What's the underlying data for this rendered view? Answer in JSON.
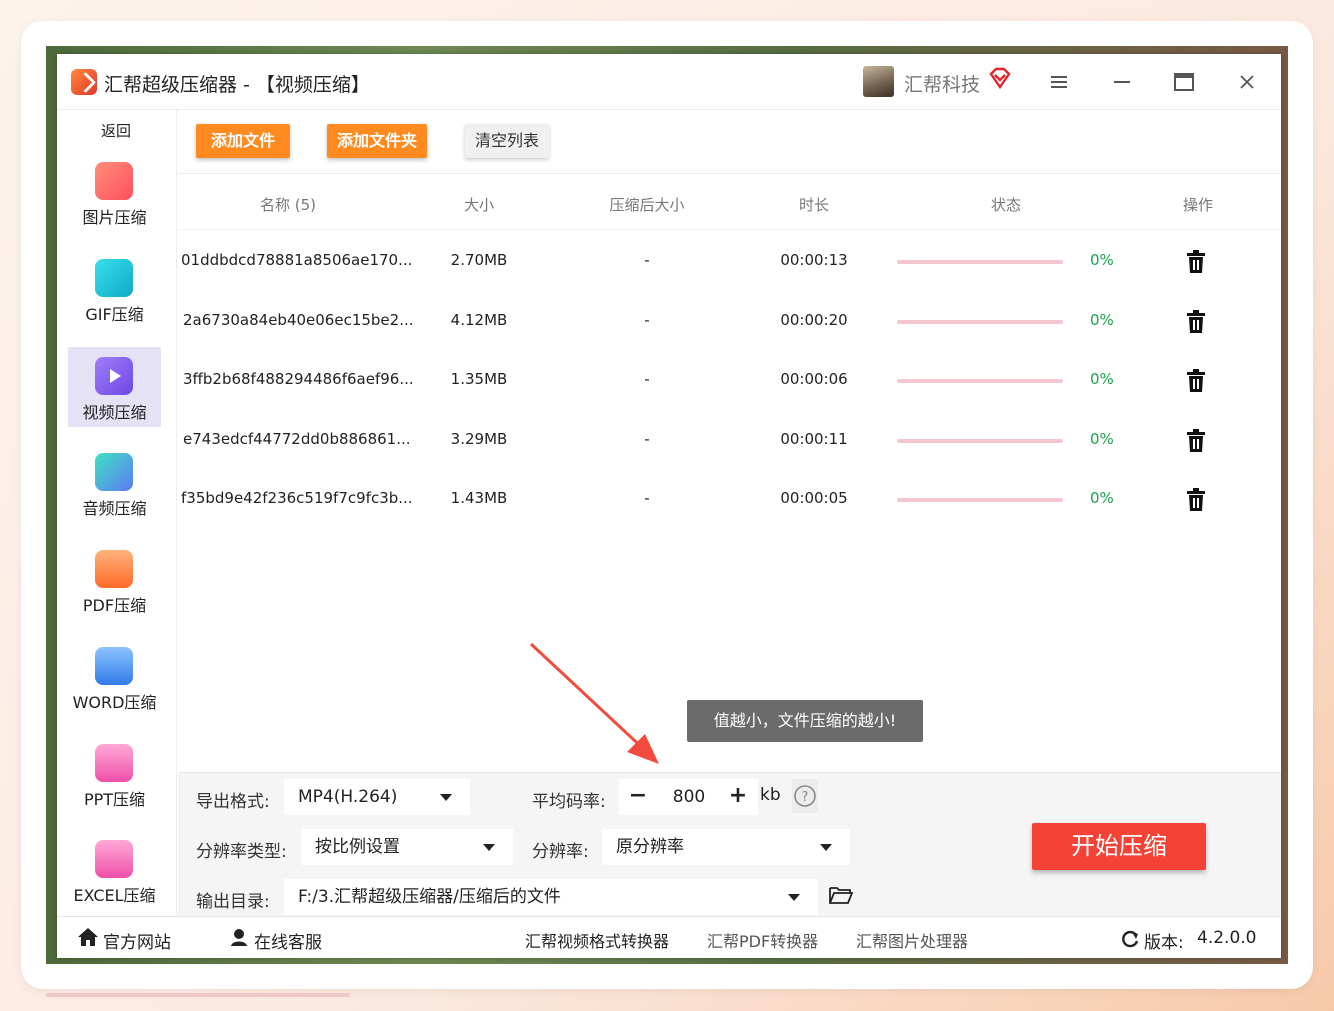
{
  "window": {
    "title": "汇帮超级压缩器  - 【视频压缩】",
    "brand": "汇帮科技"
  },
  "sidebar": {
    "back_label": "返回",
    "items": [
      {
        "label": "图片压缩",
        "icon": "image-compress-icon",
        "color": "#ff6b5a"
      },
      {
        "label": "GIF压缩",
        "icon": "gif-compress-icon",
        "color": "#1ec6d9"
      },
      {
        "label": "视频压缩",
        "icon": "video-compress-icon",
        "color": "#8a5cf0"
      },
      {
        "label": "音频压缩",
        "icon": "audio-compress-icon",
        "color": "#4aa3f0"
      },
      {
        "label": "PDF压缩",
        "icon": "pdf-compress-icon",
        "color": "#ff8a3d"
      },
      {
        "label": "WORD压缩",
        "icon": "word-compress-icon",
        "color": "#3d8bf0"
      },
      {
        "label": "PPT压缩",
        "icon": "ppt-compress-icon",
        "color": "#f064b4"
      },
      {
        "label": "EXCEL压缩",
        "icon": "excel-compress-icon",
        "color": "#f064b4"
      }
    ]
  },
  "toolbar": {
    "add_file": "添加文件",
    "add_folder": "添加文件夹",
    "clear_list": "清空列表"
  },
  "table": {
    "headers": [
      "名称 (5)",
      "大小",
      "压缩后大小",
      "时长",
      "状态",
      "操作"
    ],
    "rows": [
      {
        "name": "01ddbdcd78881a8506ae170...",
        "size": "2.70MB",
        "compressed": "-",
        "duration": "00:00:13",
        "progress": 0,
        "percent": "0%"
      },
      {
        "name": "2a6730a84eb40e06ec15be2...",
        "size": "4.12MB",
        "compressed": "-",
        "duration": "00:00:20",
        "progress": 0,
        "percent": "0%"
      },
      {
        "name": "3ffb2b68f488294486f6aef96...",
        "size": "1.35MB",
        "compressed": "-",
        "duration": "00:00:06",
        "progress": 0,
        "percent": "0%"
      },
      {
        "name": "e743edcf44772dd0b886861...",
        "size": "3.29MB",
        "compressed": "-",
        "duration": "00:00:11",
        "progress": 0,
        "percent": "0%"
      },
      {
        "name": "f35bd9e42f236c519f7c9fc3b...",
        "size": "1.43MB",
        "compressed": "-",
        "duration": "00:00:05",
        "progress": 0,
        "percent": "0%"
      }
    ]
  },
  "hint": "值越小，文件压缩的越小!",
  "settings": {
    "format_label": "导出格式:",
    "format_value": "MP4(H.264)",
    "bitrate_label": "平均码率:",
    "bitrate_value": "800",
    "bitrate_unit": "kb",
    "resolution_type_label": "分辨率类型:",
    "resolution_type_value": "按比例设置",
    "resolution_label": "分辨率:",
    "resolution_value": "原分辨率",
    "output_label": "输出目录:",
    "output_value": "F:/3.汇帮超级压缩器/压缩后的文件",
    "start_label": "开始压缩"
  },
  "footer": {
    "website": "官方网站",
    "service": "在线客服",
    "link1": "汇帮视频格式转换器",
    "link2": "汇帮PDF转换器",
    "link3": "汇帮图片处理器",
    "version_label": "版本:",
    "version_value": "4.2.0.0"
  },
  "colors": {
    "accent_orange": "#ff8a1f",
    "start_red": "#f44336",
    "progress_green": "#1aa34a"
  }
}
